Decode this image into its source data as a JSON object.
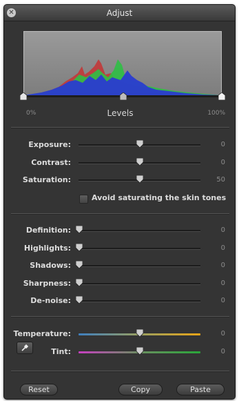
{
  "window": {
    "title": "Adjust",
    "close_icon": "close-icon"
  },
  "levels": {
    "label": "Levels",
    "min_label": "0%",
    "max_label": "100%",
    "black_point": 0.0,
    "midpoint": 0.5,
    "white_point": 1.0
  },
  "histogram": {
    "colors": {
      "red": "#d23a3a",
      "green": "#35c84a",
      "blue": "#2b3fd6"
    }
  },
  "exposure_group": [
    {
      "label": "Exposure:",
      "value": "0",
      "position": 0.5
    },
    {
      "label": "Contrast:",
      "value": "0",
      "position": 0.5
    },
    {
      "label": "Saturation:",
      "value": "50",
      "position": 0.5
    }
  ],
  "skin_tones": {
    "label": "Avoid saturating the skin tones",
    "checked": false
  },
  "detail_group": [
    {
      "label": "Definition:",
      "value": "0",
      "position": 0.0
    },
    {
      "label": "Highlights:",
      "value": "0",
      "position": 0.0
    },
    {
      "label": "Shadows:",
      "value": "0",
      "position": 0.0
    },
    {
      "label": "Sharpness:",
      "value": "0",
      "position": 0.0
    },
    {
      "label": "De-noise:",
      "value": "0",
      "position": 0.0
    }
  ],
  "color_group": [
    {
      "label": "Temperature:",
      "value": "0",
      "position": 0.5
    },
    {
      "label": "Tint:",
      "value": "0",
      "position": 0.5
    }
  ],
  "eyedropper_icon": "eyedropper-icon",
  "buttons": {
    "reset": "Reset",
    "copy": "Copy",
    "paste": "Paste"
  }
}
